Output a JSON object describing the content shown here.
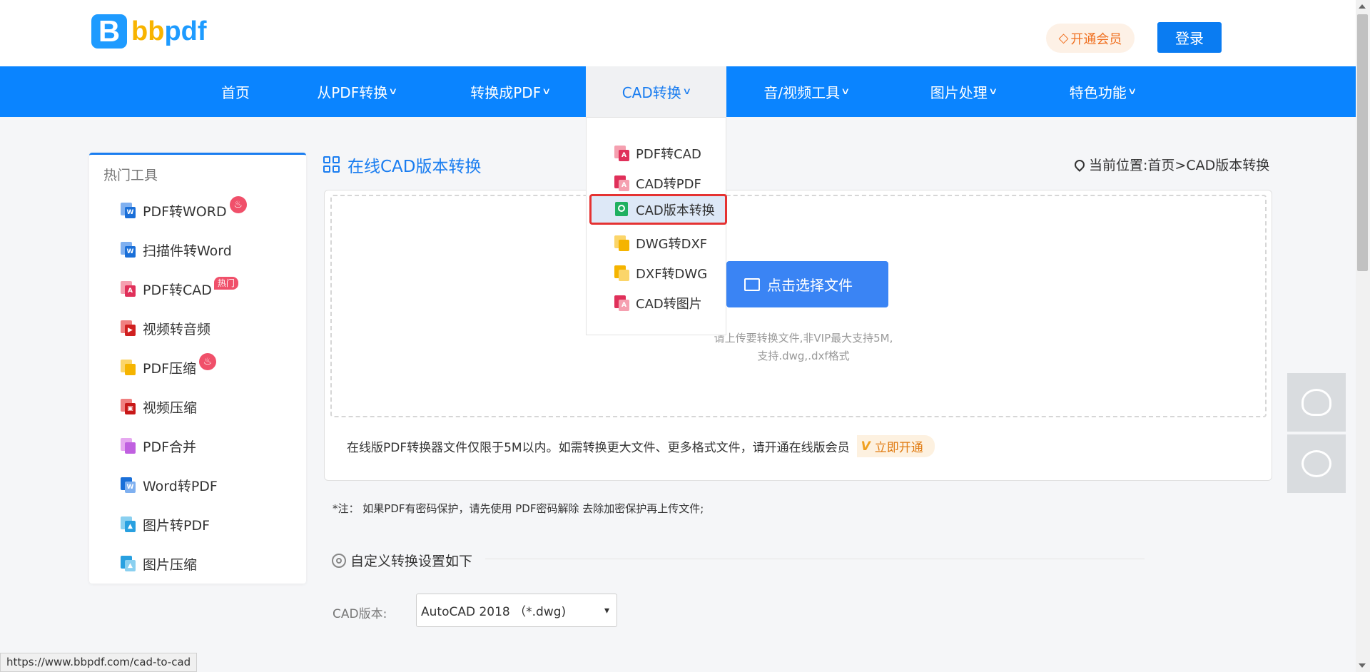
{
  "header": {
    "logo_letter": "B",
    "logo_text_1": "bb",
    "logo_text_2": "pdf",
    "vip_label": "开通会员",
    "login_label": "登录"
  },
  "nav": [
    {
      "label": "首页",
      "dropdown": false
    },
    {
      "label": "从PDF转换",
      "dropdown": true
    },
    {
      "label": "转换成PDF",
      "dropdown": true
    },
    {
      "label": "CAD转换",
      "dropdown": true,
      "active": true
    },
    {
      "label": "音/视频工具",
      "dropdown": true
    },
    {
      "label": "图片处理",
      "dropdown": true
    },
    {
      "label": "特色功能",
      "dropdown": true
    }
  ],
  "dropdown": {
    "items": [
      {
        "label": "PDF转CAD"
      },
      {
        "label": "CAD转PDF"
      },
      {
        "label": "CAD版本转换",
        "selected": true
      },
      {
        "label": "DWG转DXF"
      },
      {
        "label": "DXF转DWG"
      },
      {
        "label": "CAD转图片"
      }
    ]
  },
  "sidebar": {
    "title": "热门工具",
    "items": [
      {
        "label": "PDF转WORD",
        "badge": "fire"
      },
      {
        "label": "扫描件转Word"
      },
      {
        "label": "PDF转CAD",
        "badge": "热门"
      },
      {
        "label": "视频转音频"
      },
      {
        "label": "PDF压缩",
        "badge": "fire"
      },
      {
        "label": "视频压缩"
      },
      {
        "label": "PDF合并"
      },
      {
        "label": "Word转PDF"
      },
      {
        "label": "图片转PDF"
      },
      {
        "label": "图片压缩"
      }
    ]
  },
  "main": {
    "title": "在线CAD版本转换",
    "location": "当前位置:首页>CAD版本转换",
    "upload_button": "点击选择文件",
    "upload_hint_1": "请上传要转换文件,非VIP最大支持5M,",
    "upload_hint_2": "支持.dwg,.dxf格式",
    "limit_note": "在线版PDF转换器文件仅限于5M以内。如需转换更大文件、更多格式文件，请开通在线版会员",
    "open_now": "立即开通",
    "tip": "*注：  如果PDF有密码保护，请先使用 PDF密码解除 去除加密保护再上传文件;",
    "settings_title": "自定义转换设置如下",
    "cad_version_label": "CAD版本:",
    "cad_version_value": "AutoCAD 2018  （*.dwg)"
  },
  "status_bar": {
    "url": "https://www.bbpdf.com/cad-to-cad"
  },
  "colors": {
    "nav_blue": "#0a84ff",
    "accent_blue": "#1a7df0",
    "highlight_red": "#e53232",
    "vip_orange": "#f07020"
  }
}
